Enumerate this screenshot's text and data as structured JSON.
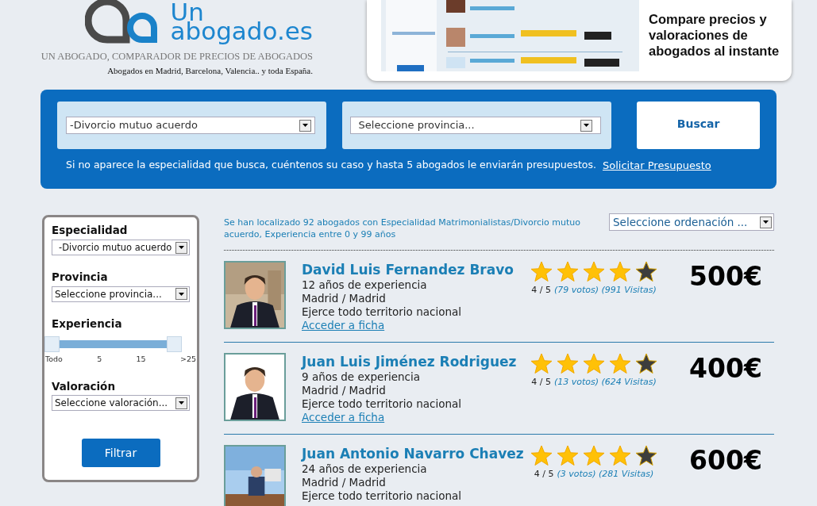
{
  "logo": {
    "line_1": "Un",
    "line_2": "abogado.es"
  },
  "tagline": "UN ABOGADO, COMPARADOR DE PRECIOS DE ABOGADOS",
  "subtagline": "Abogados en Madrid, Barcelona, Valencia.. y toda España.",
  "banner": {
    "text": "Compare precios y valoraciones de abogados al instante"
  },
  "search": {
    "specialty": "-Divorcio mutuo acuerdo",
    "province": "Seleccione provincia...",
    "button": "Buscar",
    "note": "Si no aparece la especialidad que busca, cuéntenos su caso y hasta 5 abogados le enviarán presupuestos.",
    "link": "Solicitar Presupuesto"
  },
  "filters": {
    "specialty": {
      "label": "Especialidad",
      "value": "-Divorcio mutuo acuerdo"
    },
    "province": {
      "label": "Provincia",
      "value": "Seleccione provincia..."
    },
    "experience": {
      "label": "Experiencia",
      "level": 1,
      "ticks": [
        "Todo",
        "5",
        "15",
        ">25"
      ]
    },
    "rating": {
      "label": "Valoración",
      "value": "Seleccione valoración..."
    },
    "button": "Filtrar"
  },
  "results": {
    "summary": "Se han localizado 92 abogados con Especialidad Matrimonialistas/Divorcio mutuo acuerdo, Experiencia entre 0 y 99 años",
    "sort": "Seleccione ordenación ...",
    "lawyers": [
      {
        "name": "David Luis Fernandez Bravo",
        "experience": "12 años de experiencia",
        "location": "Madrid / Madrid",
        "scope": "Ejerce todo territorio nacional",
        "link": "Acceder a ficha",
        "stars": 4,
        "score": "4 / 5",
        "votes": "(79 votos) (991 Visitas)",
        "price": "500€"
      },
      {
        "name": "Juan Luis Jiménez Rodriguez",
        "experience": "9 años de experiencia",
        "location": "Madrid / Madrid",
        "scope": "Ejerce todo territorio nacional",
        "link": "Acceder a ficha",
        "stars": 4,
        "score": "4 / 5",
        "votes": "(13 votos) (624 Visitas)",
        "price": "400€"
      },
      {
        "name": "Juan Antonio Navarro Chavez",
        "experience": "24 años de experiencia",
        "location": "Madrid / Madrid",
        "scope": "Ejerce todo territorio nacional",
        "stars": 4,
        "score": "4 / 5",
        "votes": "(3 votos) (281 Visitas)",
        "price": "600€"
      }
    ]
  }
}
